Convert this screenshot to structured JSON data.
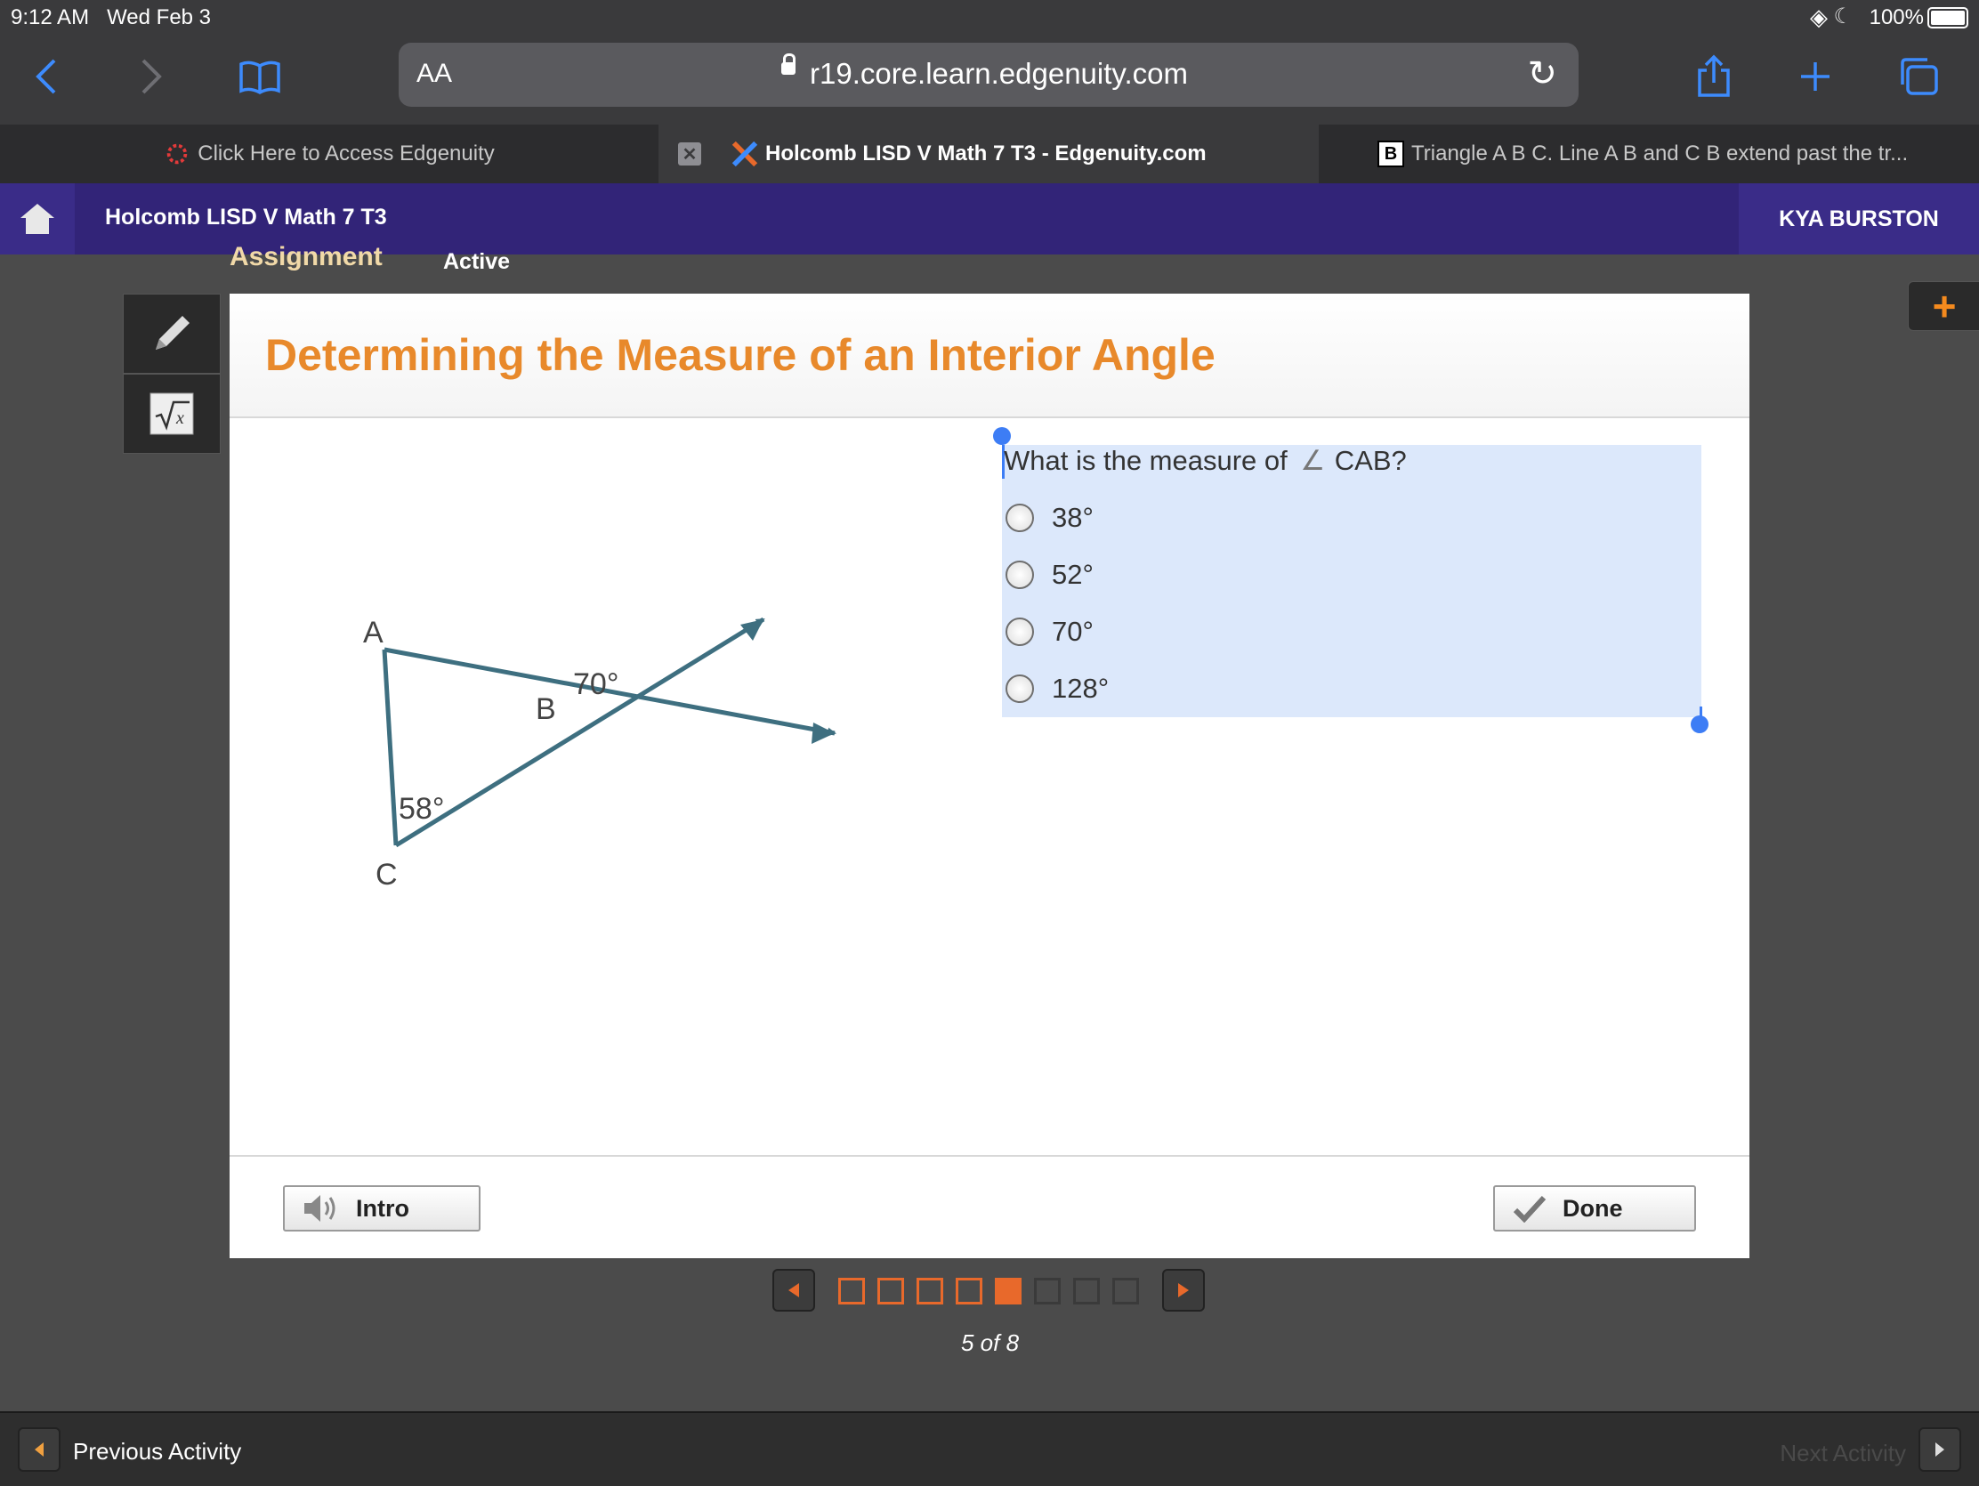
{
  "status_bar": {
    "time": "9:12 AM",
    "date": "Wed Feb 3",
    "battery": "100%"
  },
  "browser": {
    "text_size_label": "AA",
    "url": "r19.core.learn.edgenuity.com",
    "tabs": [
      {
        "label": "Click Here to Access Edgenuity"
      },
      {
        "label": "Holcomb LISD V Math 7 T3 - Edgenuity.com"
      },
      {
        "label": "Triangle A B C. Line A B and C B extend past the tr..."
      }
    ],
    "tab_icon_b": "B"
  },
  "header": {
    "course": "Holcomb LISD V Math 7 T3",
    "user": "KYA BURSTON"
  },
  "subnav": {
    "assignment": "Assignment",
    "status": "Active"
  },
  "activity": {
    "title": "Determining the Measure of an Interior Angle",
    "diagram": {
      "vertex_a": "A",
      "vertex_b": "B",
      "vertex_c": "C",
      "angle_b_exterior": "70°",
      "angle_c": "58°"
    },
    "question": {
      "prefix": "What is the measure of",
      "angle_symbol": "∠",
      "angle_name": "CAB?",
      "options": [
        "38°",
        "52°",
        "70°",
        "128°"
      ]
    },
    "intro_label": "Intro",
    "done_label": "Done"
  },
  "pager": {
    "current": 5,
    "total": 8,
    "label": "5 of 8"
  },
  "footer": {
    "previous": "Previous Activity",
    "next": "Next Activity"
  },
  "colors": {
    "header_purple": "#322478",
    "accent_orange": "#e8892b",
    "selection_blue": "#dce8fb"
  }
}
